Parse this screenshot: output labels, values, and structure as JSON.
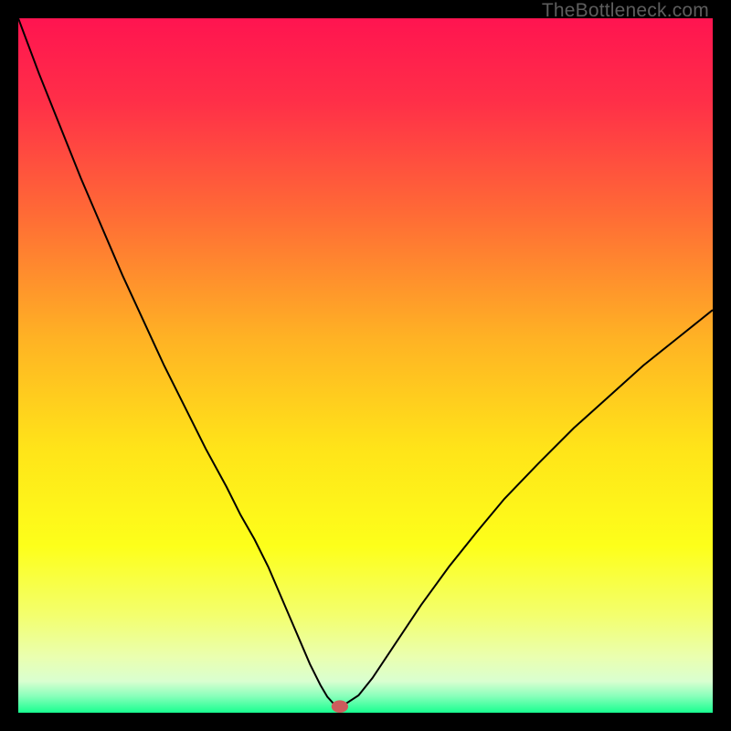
{
  "watermark": "TheBottleneck.com",
  "chart_data": {
    "type": "line",
    "title": "",
    "xlabel": "",
    "ylabel": "",
    "xlim": [
      0,
      100
    ],
    "ylim": [
      0,
      100
    ],
    "background": {
      "type": "vertical-gradient",
      "stops": [
        {
          "pos": 0.0,
          "color": "#ff1450"
        },
        {
          "pos": 0.12,
          "color": "#ff2f48"
        },
        {
          "pos": 0.28,
          "color": "#ff6a36"
        },
        {
          "pos": 0.46,
          "color": "#ffb224"
        },
        {
          "pos": 0.62,
          "color": "#ffe419"
        },
        {
          "pos": 0.76,
          "color": "#fdff1a"
        },
        {
          "pos": 0.86,
          "color": "#f3ff6e"
        },
        {
          "pos": 0.92,
          "color": "#eaffb0"
        },
        {
          "pos": 0.955,
          "color": "#d9ffd0"
        },
        {
          "pos": 0.975,
          "color": "#8dffbc"
        },
        {
          "pos": 1.0,
          "color": "#18ff90"
        }
      ]
    },
    "series": [
      {
        "name": "bottleneck-curve",
        "color": "#000000",
        "width": 2,
        "x": [
          0.0,
          3,
          6,
          9,
          12,
          15,
          18,
          21,
          24,
          27,
          30,
          32,
          34,
          36,
          37.5,
          39,
          40.5,
          42,
          43.5,
          44.5,
          45.5,
          47,
          49,
          51,
          54,
          58,
          62,
          66,
          70,
          75,
          80,
          85,
          90,
          95,
          100
        ],
        "y": [
          100,
          92,
          84.5,
          77,
          70,
          63,
          56.5,
          50,
          44,
          38,
          32.5,
          28.5,
          25,
          21,
          17.5,
          14,
          10.5,
          7,
          4,
          2.3,
          1.2,
          1.2,
          2.5,
          5,
          9.5,
          15.5,
          21,
          26,
          30.8,
          36,
          41,
          45.5,
          50,
          54,
          58
        ]
      }
    ],
    "marker": {
      "name": "optimal-point",
      "x": 46.3,
      "y": 0.9,
      "rx": 1.2,
      "ry": 0.9,
      "color": "#cd5c5c"
    }
  }
}
